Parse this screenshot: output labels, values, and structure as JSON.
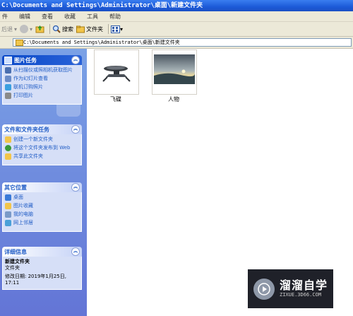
{
  "window": {
    "title": "C:\\Documents and Settings\\Administrator\\桌面\\新建文件夹"
  },
  "menu": [
    "件",
    "编辑",
    "查看",
    "收藏",
    "工具",
    "帮助"
  ],
  "toolbar": {
    "back": "后退",
    "search": "搜索",
    "folders": "文件夹"
  },
  "address": {
    "path": "C:\\Documents and Settings\\Administrator\\桌面\\新建文件夹"
  },
  "picture_tasks": {
    "title": "图片任务",
    "items": [
      "从扫描仪或照相机获取图片",
      "作为幻灯片查看",
      "联机订购照片",
      "打印图片"
    ]
  },
  "file_tasks": {
    "title": "文件和文件夹任务",
    "items": [
      "创建一个新文件夹",
      "将这个文件夹发布到 Web",
      "共享此文件夹"
    ]
  },
  "other_places": {
    "title": "其它位置",
    "items": [
      "桌面",
      "图片收藏",
      "我的电脑",
      "网上邻居"
    ]
  },
  "details": {
    "title": "详细信息",
    "name": "新建文件夹",
    "type": "文件夹",
    "modified": "修改日期: 2019年1月25日, 17:11"
  },
  "files": [
    {
      "name": "飞碟",
      "icon": "spaceship-thumbnail"
    },
    {
      "name": "人物",
      "icon": "landscape-thumbnail"
    }
  ],
  "watermark": {
    "name": "溜溜自学",
    "site": "ZIXUE.3D66.COM"
  }
}
